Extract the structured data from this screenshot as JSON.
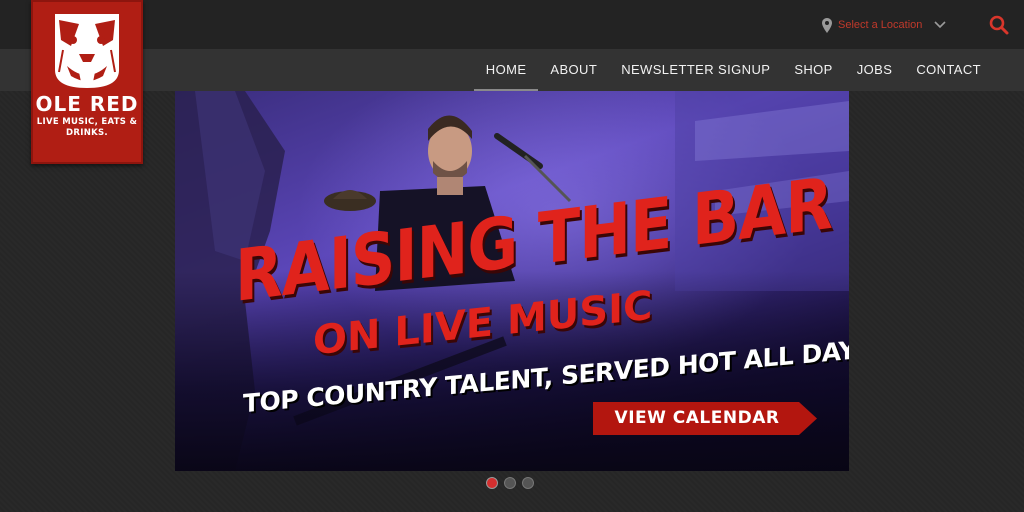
{
  "brand": {
    "logo_word": "OLE RED",
    "logo_tagline": "LIVE MUSIC, EATS & DRINKS.",
    "color": "#b01e14"
  },
  "header": {
    "location_placeholder": "Select a Location",
    "location_icon": "map-pin-icon",
    "search_icon": "search-icon"
  },
  "nav": {
    "items": [
      {
        "label": "HOME",
        "active": true
      },
      {
        "label": "ABOUT",
        "active": false
      },
      {
        "label": "NEWSLETTER SIGNUP",
        "active": false
      },
      {
        "label": "SHOP",
        "active": false
      },
      {
        "label": "JOBS",
        "active": false
      },
      {
        "label": "CONTACT",
        "active": false
      }
    ]
  },
  "hero": {
    "headline_1": "RAISING THE BAR",
    "headline_2": "ON LIVE MUSIC",
    "subline": "TOP COUNTRY TALENT, SERVED HOT ALL DAY.",
    "cta_label": "VIEW CALENDAR",
    "accent": "#e0231c"
  },
  "carousel": {
    "slide_count": 3,
    "active_index": 0
  }
}
